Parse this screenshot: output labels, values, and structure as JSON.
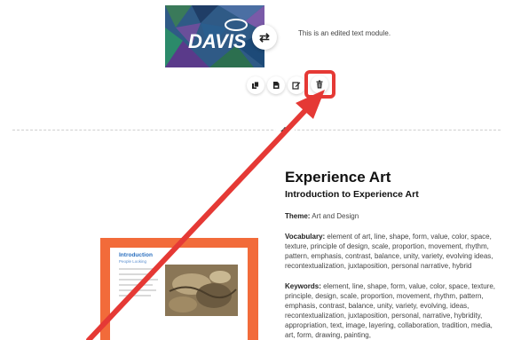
{
  "module1": {
    "logo_text": "DAVIS",
    "text": "This is an edited text module."
  },
  "toolbar": {
    "items": [
      {
        "name": "copy-icon"
      },
      {
        "name": "save-icon"
      },
      {
        "name": "edit-icon"
      },
      {
        "name": "trash-icon"
      }
    ]
  },
  "content": {
    "title": "Experience Art",
    "subtitle": "Introduction to Experience Art",
    "theme_label": "Theme:",
    "theme_value": " Art and Design",
    "vocab_label": "Vocabulary:",
    "vocab_value": " element of art, line, shape, form, value, color, space, texture, principle of design, scale, proportion, movement, rhythm, pattern, emphasis, contrast, balance, unity, variety, evolving ideas, recontextualization, juxtaposition, personal narrative, hybrid",
    "keywords_label": "Keywords:",
    "keywords_value": " element, line, shape, form, value, color, space, texture, principle, design, scale, proportion, movement, rhythm, pattern, emphasis, contrast, balance, unity, variety, evolving, ideas, recontextualization, juxtaposition, personal, narrative, hybridity, appropriation, text, image, layering, collaboration, tradition, media, art, form, drawing, painting,"
  },
  "book": {
    "title": "Introduction",
    "subtitle": "People Looking"
  },
  "colors": {
    "highlight": "#e53935",
    "arrow": "#e53935",
    "book_frame": "#f26b3a"
  }
}
